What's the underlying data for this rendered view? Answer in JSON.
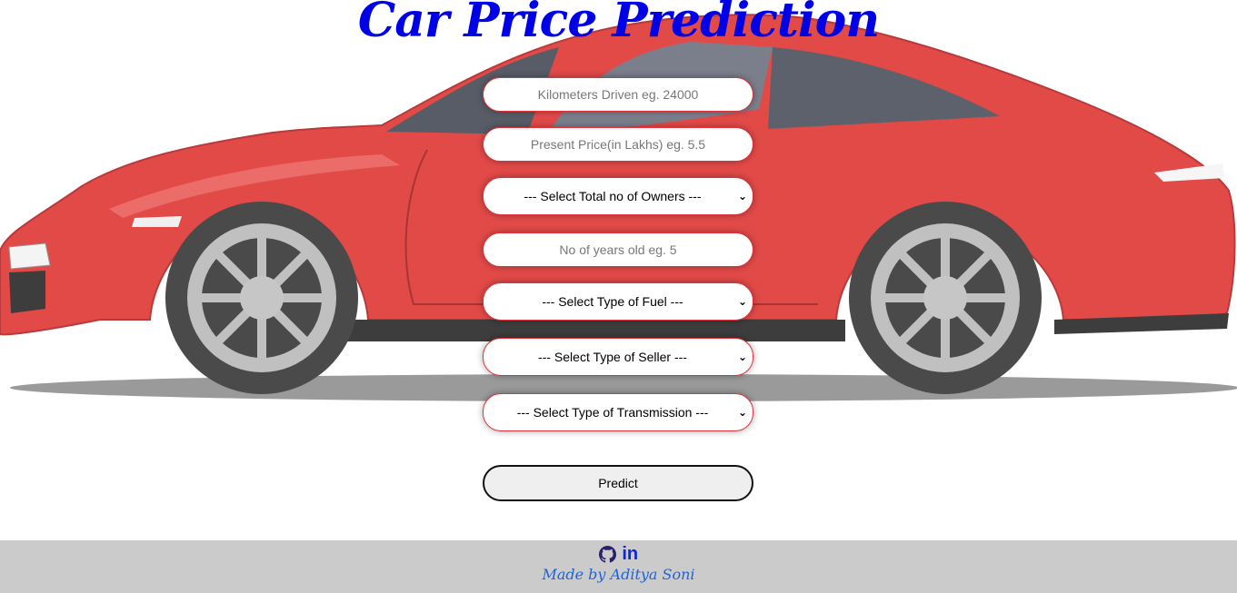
{
  "page": {
    "title": "Car Price Prediction",
    "title_color": "#0000e6"
  },
  "form": {
    "kms_placeholder": "Kilometers Driven eg. 24000",
    "price_placeholder": "Present Price(in Lakhs) eg. 5.5",
    "owners_selected": "--- Select Total no of Owners ---",
    "years_placeholder": "No of years old eg. 5",
    "fuel_selected": "--- Select Type of Fuel ---",
    "seller_selected": "--- Select Type of Seller ---",
    "transmission_selected": "--- Select Type of Transmission ---",
    "predict_label": "Predict",
    "field_border_color": "#e0323b"
  },
  "background": {
    "illustration": "red-sports-car",
    "car_color": "#e24a48"
  },
  "footer": {
    "icons": [
      "github-icon",
      "linkedin-icon"
    ],
    "linkedin_glyph": "in",
    "credit": "Made by Aditya Soni",
    "background_color": "#cbcbcb",
    "credit_color": "#1e63d8"
  }
}
